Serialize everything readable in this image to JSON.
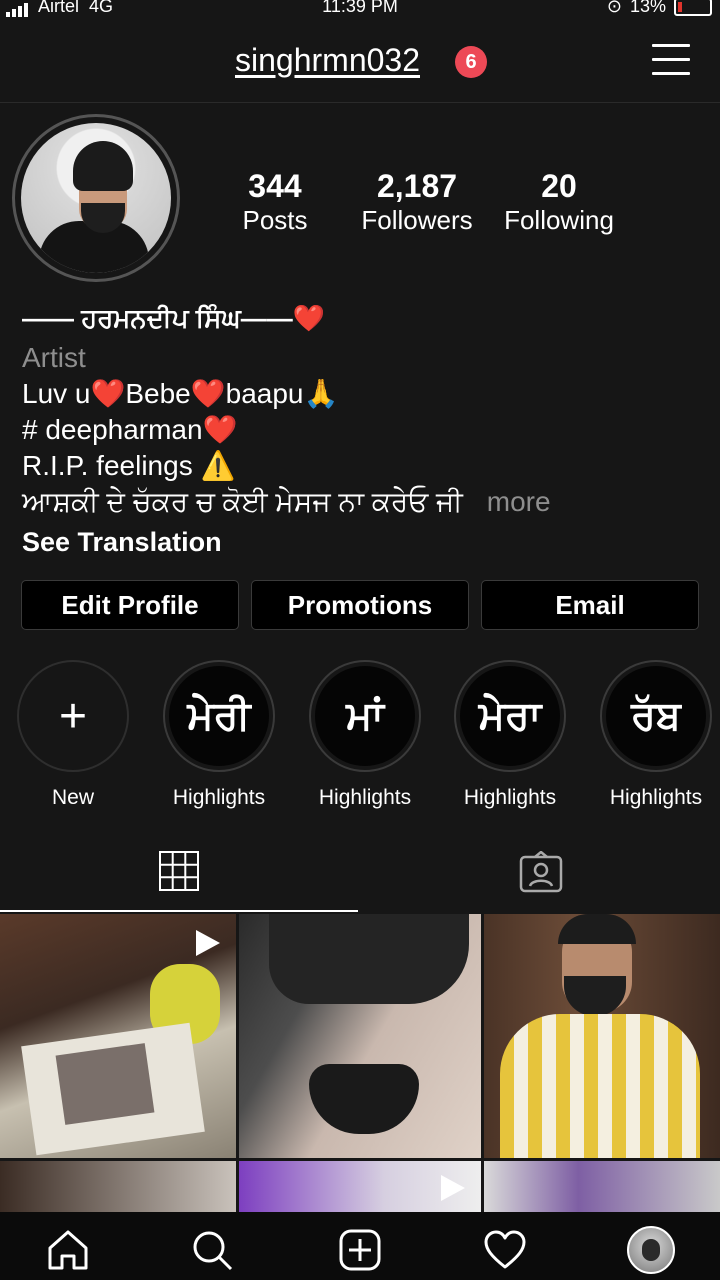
{
  "status_bar": {
    "carrier": "Airtel",
    "network": "4G",
    "time": "11:39 PM",
    "battery": "13%"
  },
  "header": {
    "username": "singhrmn032",
    "notification_count": "6"
  },
  "stats": [
    {
      "value": "344",
      "label": "Posts"
    },
    {
      "value": "2,187",
      "label": "Followers"
    },
    {
      "value": "20",
      "label": "Following"
    }
  ],
  "bio": {
    "name": "—— ਹਰਮਨਦੀਪ ਸਿੰਘ——❤️",
    "category": "Artist",
    "lines": [
      "Luv u❤️Bebe❤️baapu🙏",
      "# deepharman❤️",
      "R.I.P. feelings ⚠️",
      "ਆਸ਼ਕੀ ਦੇ ਚੱਕਰ ਚ ਕੋਈ ਮੇਸਜ ਨਾ ਕਰੇਓ ਜੀ"
    ],
    "more": "more",
    "see_translation": "See Translation"
  },
  "buttons": {
    "edit_profile": "Edit Profile",
    "promotions": "Promotions",
    "email": "Email"
  },
  "highlights": [
    {
      "cover": "+",
      "label": "New"
    },
    {
      "cover": "ਮੇਰੀ",
      "label": "Highlights"
    },
    {
      "cover": "ਮਾਂ",
      "label": "Highlights"
    },
    {
      "cover": "ਮੇਰਾ",
      "label": "Highlights"
    },
    {
      "cover": "ਰੱਬ",
      "label": "Highlights"
    }
  ],
  "tabs": [
    {
      "icon": "grid-icon",
      "active": true
    },
    {
      "icon": "tagged-icon",
      "active": false
    }
  ],
  "bottom_nav": [
    "home-icon",
    "search-icon",
    "new-post-icon",
    "activity-heart-icon",
    "profile-avatar"
  ],
  "colors": {
    "badge": "#ed4956",
    "background": "#161616"
  }
}
